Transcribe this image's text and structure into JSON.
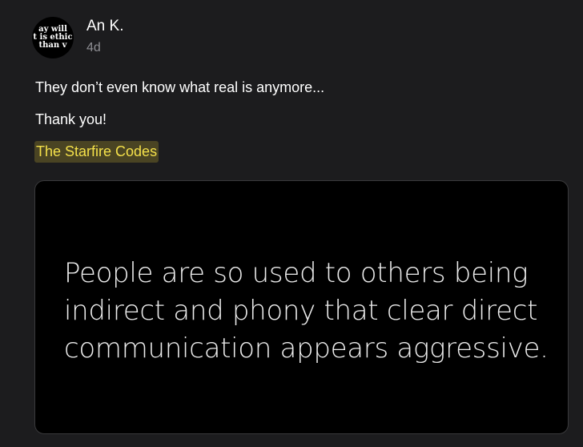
{
  "post": {
    "author": {
      "name": "An K.",
      "avatar_text": [
        "ay will",
        "t is ethic",
        "than v"
      ]
    },
    "age": "4d",
    "body_lines": [
      "They don’t even know what real is anymore...",
      "Thank you!"
    ],
    "link": {
      "label": "The Starfire Codes",
      "highlight_color": "#4a4423",
      "text_color": "#f4e04a"
    },
    "image": {
      "quote_lines": [
        "People are so used to others being",
        "indirect and phony that clear direct",
        "communication appears aggressive."
      ]
    }
  },
  "theme": {
    "background": "#1c1c1e",
    "text": "#ffffff",
    "muted": "#8e8e93"
  }
}
